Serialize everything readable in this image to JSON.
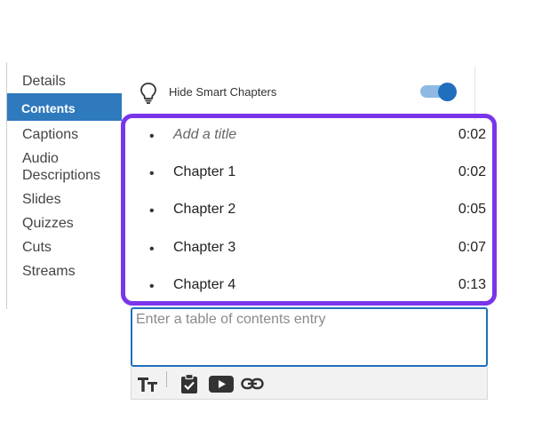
{
  "sidebar": {
    "items": [
      {
        "label": "Details"
      },
      {
        "label": "Contents",
        "active": true
      },
      {
        "label": "Captions"
      },
      {
        "label": "Audio Descriptions"
      },
      {
        "label": "Slides"
      },
      {
        "label": "Quizzes"
      },
      {
        "label": "Cuts"
      },
      {
        "label": "Streams"
      }
    ]
  },
  "header": {
    "icon": "lightbulb-icon",
    "hide_smart_chapters_label": "Hide Smart Chapters",
    "toggle_on": true
  },
  "chapters": [
    {
      "title": "Add a title",
      "time": "0:02",
      "placeholder": true
    },
    {
      "title": "Chapter 1",
      "time": "0:02"
    },
    {
      "title": "Chapter 2",
      "time": "0:05"
    },
    {
      "title": "Chapter 3",
      "time": "0:07"
    },
    {
      "title": "Chapter 4",
      "time": "0:13"
    }
  ],
  "entry": {
    "placeholder": "Enter a table of contents entry",
    "value": ""
  },
  "toolbar": {
    "icons": [
      "text-size-icon",
      "clipboard-check-icon",
      "youtube-icon",
      "link-icon"
    ]
  },
  "colors": {
    "accent": "#2f79bd",
    "highlight_border": "#7a35ea",
    "toggle_knob": "#1f6fbd",
    "toggle_track": "#8fb9e2"
  }
}
